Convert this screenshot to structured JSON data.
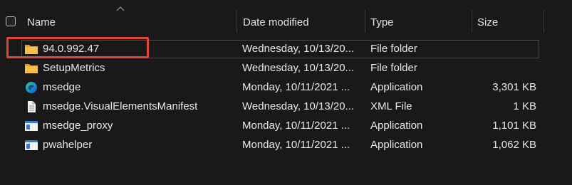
{
  "columns": {
    "name": "Name",
    "date": "Date modified",
    "type": "Type",
    "size": "Size"
  },
  "files": [
    {
      "name": "94.0.992.47",
      "date": "Wednesday, 10/13/20...",
      "type": "File folder",
      "size": "",
      "icon": "folder-icon",
      "selected": true
    },
    {
      "name": "SetupMetrics",
      "date": "Wednesday, 10/13/20...",
      "type": "File folder",
      "size": "",
      "icon": "folder-icon",
      "selected": false
    },
    {
      "name": "msedge",
      "date": "Monday, 10/11/2021 ...",
      "type": "Application",
      "size": "3,301 KB",
      "icon": "edge-icon",
      "selected": false
    },
    {
      "name": "msedge.VisualElementsManifest",
      "date": "Wednesday, 10/13/20...",
      "type": "XML File",
      "size": "1 KB",
      "icon": "document-icon",
      "selected": false
    },
    {
      "name": "msedge_proxy",
      "date": "Monday, 10/11/2021 ...",
      "type": "Application",
      "size": "1,101 KB",
      "icon": "app-window-icon",
      "selected": false
    },
    {
      "name": "pwahelper",
      "date": "Monday, 10/11/2021 ...",
      "type": "Application",
      "size": "1,062 KB",
      "icon": "app-window-icon",
      "selected": false
    }
  ],
  "colors": {
    "background": "#191919",
    "highlight": "#e0453a",
    "folder": "#f4c04a",
    "app_icon": "#2f7bd6"
  }
}
